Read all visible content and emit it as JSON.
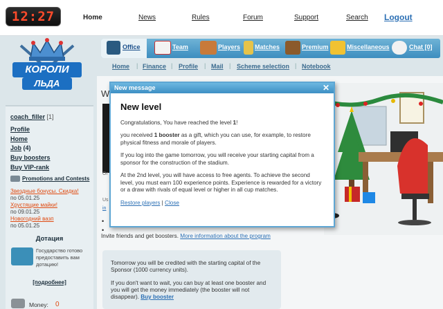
{
  "clock": "12:27",
  "topnav": {
    "home": "Home",
    "news": "News",
    "rules": "Rules",
    "forum": "Forum",
    "support": "Support",
    "search": "Search",
    "logout": "Logout"
  },
  "logo": {
    "line1": "КОРОЛИ",
    "line2": "ЛЬДА"
  },
  "tabs": {
    "office": "Office",
    "team": "Team",
    "players": "Players",
    "matches": "Matches",
    "premium": "Premium",
    "misc": "Miscellaneous",
    "chat": "Chat [0]"
  },
  "subnav": [
    "Home",
    "Finance",
    "Profile",
    "Mail",
    "Scheme selection",
    "Notebook"
  ],
  "sidebar": {
    "user": "coach_filler",
    "user_count": "[1]",
    "links": [
      "Profile",
      "Home",
      "Job",
      "Buy boosters",
      "Buy VIP-rank"
    ],
    "job_count": "(4)",
    "promos_title": "Promotions and Contests",
    "promos": [
      {
        "title": "Звездные бонусы. Скидка!",
        "date": "по 05.01.25"
      },
      {
        "title": "Хрустящие майки!",
        "date": "по 09.01.25"
      },
      {
        "title": "Новогодний вазп",
        "date": "по 05.01.25"
      }
    ],
    "subsidy_title": "Дотация",
    "subsidy_text": "Государство готово предоставить вам дотацию!",
    "more": "[подробнее]",
    "money_label": "Money:",
    "money_value": "0"
  },
  "main": {
    "w_letter": "W",
    "invite_text": "Invite friends and get boosters.",
    "invite_link": "More information about the program"
  },
  "dialog": {
    "bar_title": "New message",
    "title": "New level",
    "p1_pre": "Congratulations, You have reached the level ",
    "p1_level": "1",
    "p1_post": "!",
    "p2_pre": "you received ",
    "p2_bold": "1 booster",
    "p2_post": " as a gift, which you can use, for example, to restore physical fitness and morale of players.",
    "p3": "If you log into the game tomorrow, you will receive your starting capital from a sponsor for the construction of the stadium.",
    "p4": "At the 2nd level, you will have access to free agents. To achieve the second level, you must earn 100 experience points. Experience is rewarded for a victory or a draw with rivals of equal level or higher in all cup matches.",
    "link_restore": "Restore players",
    "link_sep": "|",
    "link_close": "Close"
  },
  "infobox": {
    "p1": "Tomorrow you will be credited with the starting capital of the Sponsor (1000 currency units).",
    "p2": "If you don't want to wait, you can buy at least one booster and you will get the money immediately (the booster will not disappear).",
    "link": "Buy booster"
  }
}
